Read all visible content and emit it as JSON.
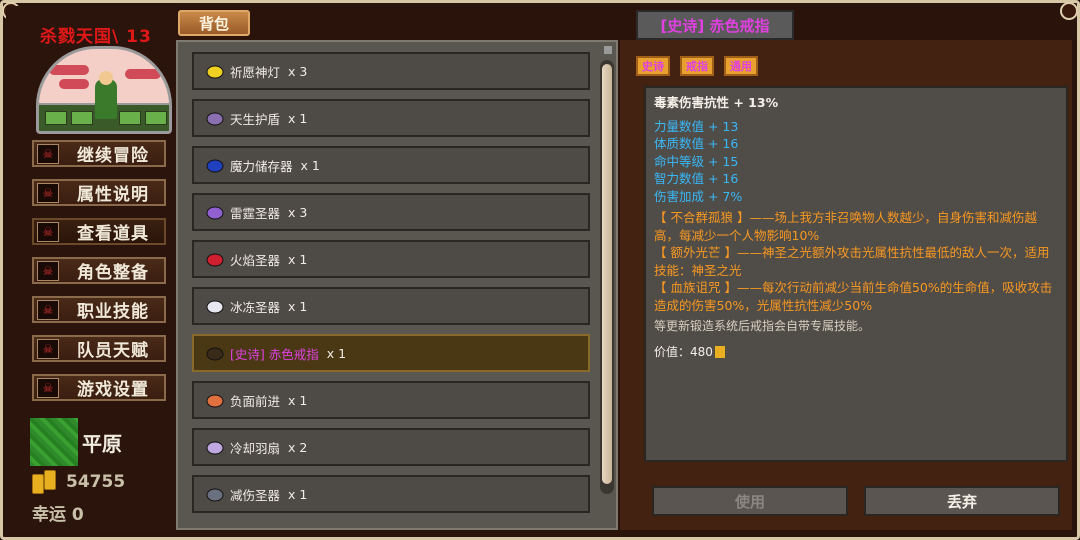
{
  "sidebar": {
    "realm_title": "杀戮天国\\ 13",
    "menu": [
      "继续冒险",
      "属性说明",
      "查看道具",
      "角色整备",
      "职业技能",
      "队员天赋",
      "游戏设置"
    ],
    "terrain": "平原",
    "gold": "54755",
    "luck": "幸运 0"
  },
  "bag": {
    "tab_label": "背包",
    "items": [
      {
        "name": "祈愿神灯",
        "qty": "x 3",
        "icon": "magic-lamp-icon",
        "color": "#f0d020"
      },
      {
        "name": "天生护盾",
        "qty": "x 1",
        "icon": "shield-orb-icon",
        "color": "#8a70b0"
      },
      {
        "name": "魔力储存器",
        "qty": "x 1",
        "icon": "mana-flask-icon",
        "color": "#2040c0"
      },
      {
        "name": "雷霆圣器",
        "qty": "x 3",
        "icon": "thunder-relic-icon",
        "color": "#9060d0"
      },
      {
        "name": "火焰圣器",
        "qty": "x 1",
        "icon": "fire-relic-icon",
        "color": "#d02030"
      },
      {
        "name": "冰冻圣器",
        "qty": "x 1",
        "icon": "ice-relic-icon",
        "color": "#e8e8f0"
      },
      {
        "prefix": "[史诗]",
        "name": "赤色戒指",
        "qty": "x 1",
        "icon": "ring-icon",
        "color": "#3a2a1a"
      },
      {
        "name": "负面前进",
        "qty": "x 1",
        "icon": "negative-advance-icon",
        "color": "#e07040"
      },
      {
        "name": "冷却羽扇",
        "qty": "x 2",
        "icon": "feather-fan-icon",
        "color": "#c0a8e0"
      },
      {
        "name": "减伤圣器",
        "qty": "x 1",
        "icon": "damage-reduce-relic-icon",
        "color": "#6a7080"
      }
    ],
    "selected_index": 6
  },
  "detail": {
    "title": "[史诗] 赤色戒指",
    "tags": [
      "史诗",
      "戒指",
      "通用"
    ],
    "main_stat": "毒素伤害抗性 + 13%",
    "stats": [
      "力量数值 + 13",
      "体质数值 + 16",
      "命中等级 + 15",
      "智力数值 + 16",
      "伤害加成 + 7%"
    ],
    "traits": [
      "【 不合群孤狼 】——场上我方非召唤物人数越少，自身伤害和减伤越高，每减少一个人物影响10%",
      "【 额外光芒 】——神圣之光额外攻击光属性抗性最低的敌人一次，适用技能：神圣之光",
      "【 血族诅咒 】——每次行动前减少当前生命值50%的生命值，吸收攻击造成的伤害50%，光属性抗性减少50%"
    ],
    "note": "等更新锻造系统后戒指会自带专属技能。",
    "value": "价值：480"
  },
  "buttons": {
    "use": "使用",
    "drop": "丢弃"
  }
}
